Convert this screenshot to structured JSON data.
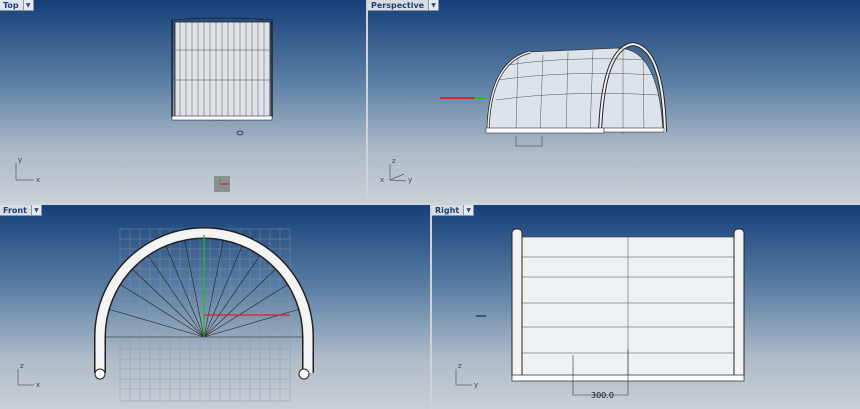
{
  "viewports": {
    "top": {
      "title": "Top",
      "axis_x": "x",
      "axis_y": "y"
    },
    "perspective": {
      "title": "Perspective",
      "axis_x": "x",
      "axis_y": "y",
      "axis_z": "z"
    },
    "front": {
      "title": "Front",
      "axis_x": "x",
      "axis_z": "z"
    },
    "right": {
      "title": "Right",
      "axis_y": "y",
      "axis_z": "z",
      "dimension": "300.0"
    }
  },
  "icons": {
    "dropdown": "chevron-down-icon"
  },
  "colors": {
    "x_axis": "#e02020",
    "y_axis": "#20c020",
    "viewport_top": "#153f78"
  }
}
